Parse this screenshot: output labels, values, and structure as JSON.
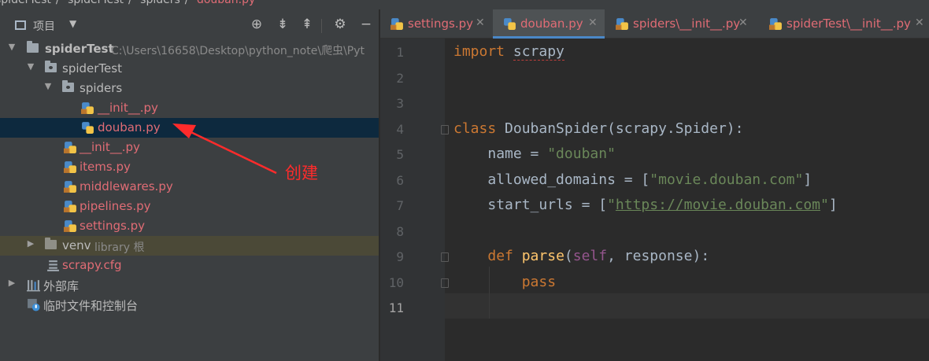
{
  "breadcrumb": {
    "items": [
      "spiderTest",
      "spiderTest",
      "spiders",
      "douban.py"
    ]
  },
  "project_panel": {
    "title": "项目",
    "tree": [
      {
        "label": "spiderTest",
        "path": "C:\\Users\\16658\\Desktop\\python_note\\爬虫\\Pyt"
      },
      {
        "label": "spiderTest"
      },
      {
        "label": "spiders"
      },
      {
        "label": "__init__.py"
      },
      {
        "label": "douban.py"
      },
      {
        "label": "__init__.py"
      },
      {
        "label": "items.py"
      },
      {
        "label": "middlewares.py"
      },
      {
        "label": "pipelines.py"
      },
      {
        "label": "settings.py"
      },
      {
        "label": "venv",
        "extra": "library 根"
      },
      {
        "label": "scrapy.cfg"
      },
      {
        "label": "外部库"
      },
      {
        "label": "临时文件和控制台"
      }
    ]
  },
  "annotation": {
    "text": "创建",
    "color": "#ff2b2b"
  },
  "tabs": [
    {
      "label": "settings.py"
    },
    {
      "label": "douban.py",
      "active": true
    },
    {
      "label": "spiders\\__init__.py"
    },
    {
      "label": "spiderTest\\__init__.py"
    }
  ],
  "editor": {
    "line_numbers": [
      "1",
      "2",
      "3",
      "4",
      "5",
      "6",
      "7",
      "8",
      "9",
      "10",
      "11"
    ],
    "current_line": 11,
    "code": {
      "l1_kw": "import",
      "l1_mod": "scrapy",
      "l4_kw": "class",
      "l4_rest": "DoubanSpider(scrapy.Spider):",
      "l5_a": "name = ",
      "l5_str": "\"douban\"",
      "l6_a": "allowed_domains = [",
      "l6_str": "\"movie.douban.com\"",
      "l6_b": "]",
      "l7_a": "start_urls = [",
      "l7_q1": "\"",
      "l7_url": "https://movie.douban.com",
      "l7_q2": "\"",
      "l7_b": "]",
      "l9_kw": "def",
      "l9_fn": "parse",
      "l9_p1": "(",
      "l9_self": "self",
      "l9_p2": ", response):",
      "l10_kw": "pass"
    }
  },
  "colors": {
    "panel_bg": "#3c3f41",
    "editor_bg": "#2b2b2b",
    "selection": "#0d293e",
    "modified_file": "#e06c75",
    "active_tab_underline": "#4a88c7"
  }
}
